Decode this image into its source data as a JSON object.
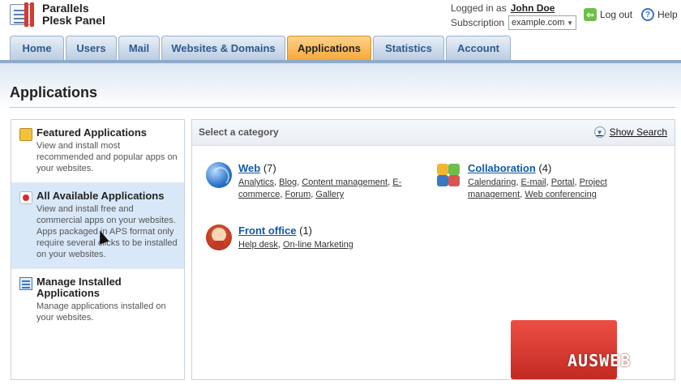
{
  "brand": {
    "line1": "Parallels",
    "line2": "Plesk Panel"
  },
  "login": {
    "label": "Logged in as",
    "user": "John Doe"
  },
  "subscription": {
    "label": "Subscription",
    "value": "example.com"
  },
  "utility": {
    "logout": "Log out",
    "help": "Help"
  },
  "tabs": [
    {
      "label": "Home"
    },
    {
      "label": "Users"
    },
    {
      "label": "Mail"
    },
    {
      "label": "Websites & Domains"
    },
    {
      "label": "Applications"
    },
    {
      "label": "Statistics"
    },
    {
      "label": "Account"
    }
  ],
  "active_tab": "Applications",
  "page_title": "Applications",
  "nav": [
    {
      "title": "Featured Applications",
      "desc": "View and install most recommended and popular apps on your websites."
    },
    {
      "title": "All Available Applications",
      "desc": "View and install free and commercial apps on your websites. Apps packaged in APS format only require several clicks to be installed on your websites."
    },
    {
      "title": "Manage Installed Applications",
      "desc": "Manage applications installed on your websites."
    }
  ],
  "category_header": {
    "label": "Select a category",
    "show_search": "Show Search"
  },
  "categories": {
    "web": {
      "name": "Web",
      "count": "(7)",
      "links": [
        "Analytics",
        "Blog",
        "Content management",
        "E-commerce",
        "Forum",
        "Gallery"
      ]
    },
    "collaboration": {
      "name": "Collaboration",
      "count": "(4)",
      "links": [
        "Calendaring",
        "E-mail",
        "Portal",
        "Project management",
        "Web conferencing"
      ]
    },
    "front_office": {
      "name": "Front office",
      "count": "(1)",
      "links": [
        "Help desk",
        "On-line Marketing"
      ]
    }
  },
  "watermark": {
    "text": "AUSWEB"
  },
  "colors": {
    "tab_active": "#f5a93a",
    "tab_inactive": "#bccde2",
    "link": "#0f5aa8",
    "selected_row": "#d9e8f8"
  }
}
